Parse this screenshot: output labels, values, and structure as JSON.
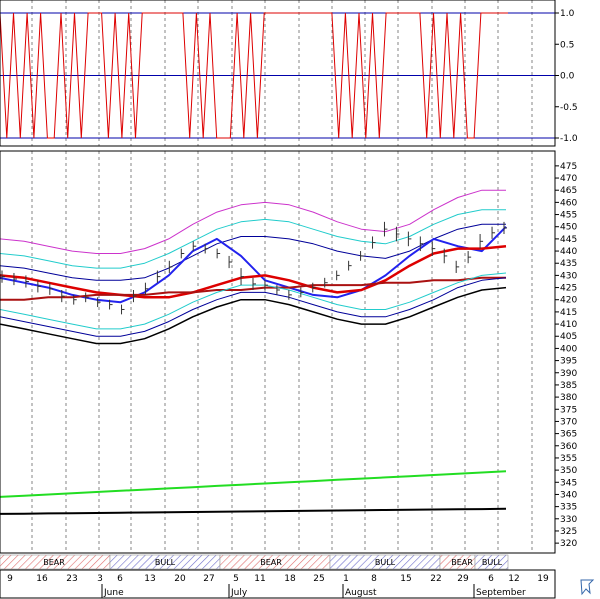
{
  "chart_data": [
    {
      "type": "line",
      "title": "",
      "ylim": [
        -1.0,
        1.0
      ],
      "y_ticks": [
        "1.0",
        "0.5",
        "0.0",
        "-0.5",
        "-1.0"
      ],
      "reference_lines": [
        1.0,
        0.0,
        -1.0
      ],
      "series": [
        {
          "color": "#dd0000",
          "values": [
            1,
            -1,
            1,
            -1,
            1,
            -1,
            1,
            -1,
            -1,
            1,
            -1,
            1,
            -1,
            1,
            1,
            1,
            -1,
            1,
            -1,
            1,
            -1,
            1,
            1,
            1,
            1,
            1,
            1,
            1,
            -1,
            1,
            -1,
            1,
            -1,
            -1,
            -1,
            1,
            -1,
            1,
            -1,
            1,
            1,
            1,
            1,
            1,
            1,
            1,
            1,
            1,
            1,
            1,
            -1,
            1,
            -1,
            1,
            -1,
            1,
            -1,
            1,
            1,
            1,
            1,
            1,
            1,
            -1,
            1,
            -1,
            1,
            -1,
            1,
            -1,
            -1,
            1,
            1,
            1,
            1,
            1
          ]
        }
      ]
    },
    {
      "type": "line",
      "title": "",
      "ylim": [
        318,
        477
      ],
      "y_ticks": [
        "475",
        "470",
        "465",
        "460",
        "455",
        "450",
        "445",
        "440",
        "435",
        "430",
        "425",
        "420",
        "415",
        "410",
        "405",
        "400",
        "395",
        "390",
        "385",
        "380",
        "375",
        "370",
        "365",
        "360",
        "355",
        "350",
        "345",
        "340",
        "335",
        "330",
        "325",
        "320"
      ],
      "grid": "vertical-dashed",
      "price_bars": [
        {
          "h": 432,
          "l": 427
        },
        {
          "h": 431,
          "l": 426
        },
        {
          "h": 430,
          "l": 425
        },
        {
          "h": 428,
          "l": 423
        },
        {
          "h": 427,
          "l": 422
        },
        {
          "h": 424,
          "l": 419
        },
        {
          "h": 422,
          "l": 418
        },
        {
          "h": 423,
          "l": 419
        },
        {
          "h": 421,
          "l": 417
        },
        {
          "h": 420,
          "l": 416
        },
        {
          "h": 418,
          "l": 414
        },
        {
          "h": 424,
          "l": 419
        },
        {
          "h": 427,
          "l": 422
        },
        {
          "h": 432,
          "l": 427
        },
        {
          "h": 436,
          "l": 431
        },
        {
          "h": 441,
          "l": 437
        },
        {
          "h": 444,
          "l": 440
        },
        {
          "h": 443,
          "l": 439
        },
        {
          "h": 441,
          "l": 437
        },
        {
          "h": 438,
          "l": 433
        },
        {
          "h": 433,
          "l": 426
        },
        {
          "h": 429,
          "l": 424
        },
        {
          "h": 428,
          "l": 424
        },
        {
          "h": 426,
          "l": 422
        },
        {
          "h": 424,
          "l": 420
        },
        {
          "h": 425,
          "l": 421
        },
        {
          "h": 427,
          "l": 423
        },
        {
          "h": 429,
          "l": 425
        },
        {
          "h": 432,
          "l": 428
        },
        {
          "h": 436,
          "l": 432
        },
        {
          "h": 440,
          "l": 436
        },
        {
          "h": 446,
          "l": 441
        },
        {
          "h": 452,
          "l": 446
        },
        {
          "h": 450,
          "l": 444
        },
        {
          "h": 448,
          "l": 442
        },
        {
          "h": 446,
          "l": 440
        },
        {
          "h": 444,
          "l": 438
        },
        {
          "h": 441,
          "l": 435
        },
        {
          "h": 436,
          "l": 431
        },
        {
          "h": 440,
          "l": 435
        },
        {
          "h": 447,
          "l": 441
        },
        {
          "h": 450,
          "l": 445
        },
        {
          "h": 452,
          "l": 447
        }
      ],
      "series": [
        {
          "color": "#cc33cc",
          "values": [
            445,
            444,
            442,
            440,
            439,
            439,
            441,
            445,
            451,
            456,
            459,
            460,
            459,
            456,
            452,
            449,
            448,
            451,
            457,
            462,
            465,
            465
          ]
        },
        {
          "color": "#22cccc",
          "values": [
            439,
            438,
            436,
            434,
            433,
            433,
            435,
            439,
            444,
            449,
            452,
            453,
            452,
            449,
            446,
            444,
            443,
            446,
            451,
            455,
            457,
            457
          ]
        },
        {
          "color": "#000099",
          "values": [
            434,
            433,
            431,
            429,
            428,
            428,
            429,
            433,
            438,
            443,
            446,
            446,
            445,
            443,
            440,
            438,
            437,
            440,
            445,
            449,
            451,
            451
          ]
        },
        {
          "color": "#2222ee",
          "values": [
            429,
            427,
            425,
            422,
            420,
            419,
            423,
            430,
            440,
            445,
            438,
            428,
            425,
            422,
            421,
            424,
            430,
            438,
            445,
            442,
            440,
            450
          ]
        },
        {
          "color": "#dd0000",
          "values": [
            430,
            429,
            427,
            425,
            423,
            422,
            421,
            421,
            423,
            426,
            429,
            430,
            428,
            425,
            423,
            424,
            428,
            434,
            439,
            441,
            441,
            442
          ]
        },
        {
          "color": "#aa1111",
          "values": [
            420,
            420,
            421,
            421,
            422,
            422,
            422,
            423,
            423,
            424,
            424,
            425,
            425,
            426,
            426,
            426,
            427,
            427,
            428,
            428,
            429,
            429
          ]
        },
        {
          "color": "#000099",
          "values": [
            413,
            411,
            409,
            407,
            405,
            405,
            407,
            411,
            416,
            420,
            423,
            423,
            421,
            418,
            415,
            413,
            413,
            416,
            420,
            425,
            428,
            429
          ]
        },
        {
          "color": "#22cccc",
          "values": [
            416,
            414,
            412,
            410,
            408,
            408,
            410,
            414,
            419,
            423,
            426,
            426,
            424,
            421,
            418,
            416,
            416,
            419,
            423,
            427,
            430,
            431
          ]
        },
        {
          "color": "#000000",
          "values": [
            410,
            408,
            406,
            404,
            402,
            402,
            404,
            408,
            413,
            417,
            420,
            420,
            418,
            415,
            412,
            410,
            410,
            413,
            417,
            421,
            424,
            425
          ]
        },
        {
          "color": "#22dd22",
          "values": [
            339,
            339.5,
            340,
            340.5,
            341,
            341.5,
            342,
            342.5,
            343,
            343.5,
            344,
            344.5,
            345,
            345.5,
            346,
            346.5,
            347,
            347.5,
            348,
            348.5,
            349,
            349.5
          ]
        },
        {
          "color": "#000000",
          "values": [
            332,
            332.1,
            332.2,
            332.3,
            332.4,
            332.5,
            332.6,
            332.7,
            332.8,
            332.9,
            333,
            333.1,
            333.2,
            333.3,
            333.4,
            333.5,
            333.6,
            333.7,
            333.8,
            333.9,
            334,
            334.1
          ]
        }
      ]
    }
  ],
  "phases": [
    "BEAR",
    "BULL",
    "BEAR",
    "BULL",
    "BEAR",
    "BULL"
  ],
  "x_axis": {
    "day_labels": [
      "9",
      "16",
      "23",
      "3",
      "6",
      "13",
      "20",
      "27",
      "5",
      "11",
      "18",
      "25",
      "1",
      "8",
      "15",
      "22",
      "29",
      "6",
      "12",
      "19"
    ],
    "month_labels": [
      "June",
      "July",
      "August",
      "September"
    ]
  },
  "corner_icon": "cursor-icon"
}
